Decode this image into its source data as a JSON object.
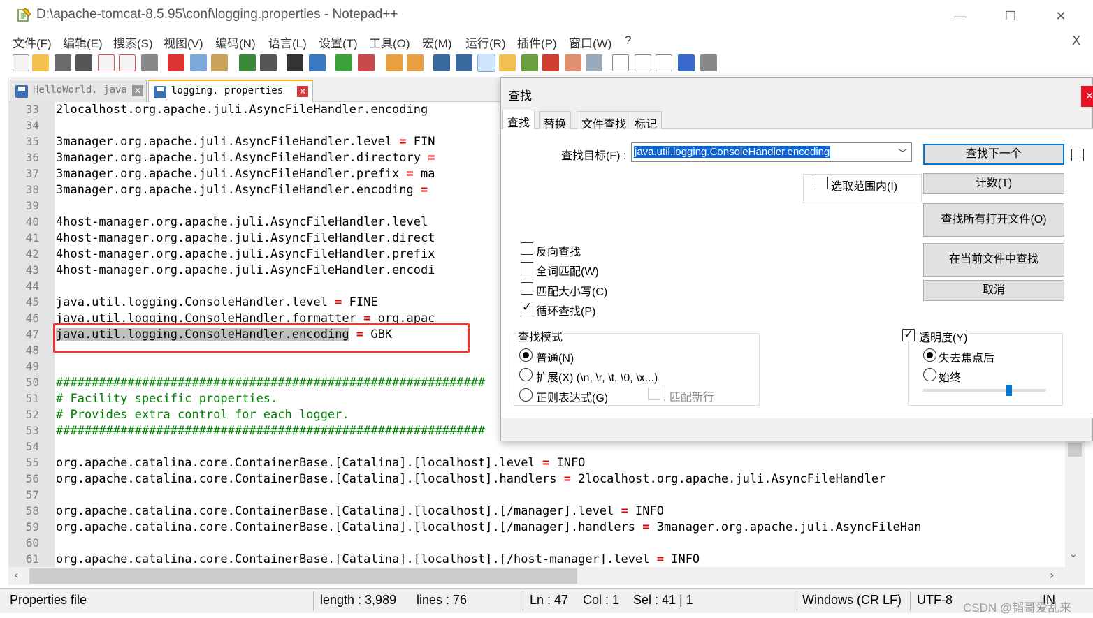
{
  "window": {
    "title": "D:\\apache-tomcat-8.5.95\\conf\\logging.properties - Notepad++",
    "min": "—",
    "max": "☐",
    "close": "✕"
  },
  "menu": [
    "文件(F)",
    "编辑(E)",
    "搜索(S)",
    "视图(V)",
    "编码(N)",
    "语言(L)",
    "设置(T)",
    "工具(O)",
    "宏(M)",
    "运行(R)",
    "插件(P)",
    "窗口(W)",
    "?"
  ],
  "menu_close": "X",
  "tabs": [
    {
      "label": "HelloWorld. java",
      "active": false
    },
    {
      "label": "logging. properties",
      "active": true
    }
  ],
  "editor": {
    "lines": [
      {
        "n": "33",
        "t": "2localhost.org.apache.juli.AsyncFileHandler.encoding"
      },
      {
        "n": "34",
        "t": ""
      },
      {
        "n": "35",
        "t": "3manager.org.apache.juli.AsyncFileHandler.level ",
        "eq": "=",
        "r": " FIN"
      },
      {
        "n": "36",
        "t": "3manager.org.apache.juli.AsyncFileHandler.directory ",
        "eq": "="
      },
      {
        "n": "37",
        "t": "3manager.org.apache.juli.AsyncFileHandler.prefix ",
        "eq": "=",
        "r": " ma"
      },
      {
        "n": "38",
        "t": "3manager.org.apache.juli.AsyncFileHandler.encoding ",
        "eq": "="
      },
      {
        "n": "39",
        "t": ""
      },
      {
        "n": "40",
        "t": "4host-manager.org.apache.juli.AsyncFileHandler.level"
      },
      {
        "n": "41",
        "t": "4host-manager.org.apache.juli.AsyncFileHandler.direct"
      },
      {
        "n": "42",
        "t": "4host-manager.org.apache.juli.AsyncFileHandler.prefix"
      },
      {
        "n": "43",
        "t": "4host-manager.org.apache.juli.AsyncFileHandler.encodi"
      },
      {
        "n": "44",
        "t": ""
      },
      {
        "n": "45",
        "t": "java.util.logging.ConsoleHandler.level ",
        "eq": "=",
        "r": " FINE"
      },
      {
        "n": "46",
        "t": "java.util.logging.ConsoleHandler.formatter ",
        "eq": "=",
        "r": " org.apac"
      },
      {
        "n": "47",
        "t": "java.util.logging.ConsoleHandler.encoding",
        "sel": true,
        "mid": " ",
        "eq": "=",
        "r": " GBK"
      },
      {
        "n": "48",
        "t": ""
      },
      {
        "n": "49",
        "t": ""
      },
      {
        "n": "50",
        "t": "############################################################",
        "cm": true
      },
      {
        "n": "51",
        "t": "# Facility specific properties.",
        "cm": true
      },
      {
        "n": "52",
        "t": "# Provides extra control for each logger.",
        "cm": true
      },
      {
        "n": "53",
        "t": "############################################################",
        "cm": true
      },
      {
        "n": "54",
        "t": ""
      },
      {
        "n": "55",
        "t": "org.apache.catalina.core.ContainerBase.[Catalina].[localhost].level ",
        "eq": "=",
        "r": " INFO"
      },
      {
        "n": "56",
        "t": "org.apache.catalina.core.ContainerBase.[Catalina].[localhost].handlers ",
        "eq": "=",
        "r": " 2localhost.org.apache.juli.AsyncFileHandler"
      },
      {
        "n": "57",
        "t": ""
      },
      {
        "n": "58",
        "t": "org.apache.catalina.core.ContainerBase.[Catalina].[localhost].[/manager].level ",
        "eq": "=",
        "r": " INFO"
      },
      {
        "n": "59",
        "t": "org.apache.catalina.core.ContainerBase.[Catalina].[localhost].[/manager].handlers ",
        "eq": "=",
        "r": " 3manager.org.apache.juli.AsyncFileHan"
      },
      {
        "n": "60",
        "t": ""
      },
      {
        "n": "61",
        "t": "org.apache.catalina.core.ContainerBase.[Catalina].[localhost].[/host-manager].level ",
        "eq": "=",
        "r": " INFO"
      }
    ]
  },
  "status": {
    "filetype": "Properties file",
    "length": "length : 3,989",
    "lines": "lines : 76",
    "ln": "Ln : 47",
    "col": "Col : 1",
    "sel": "Sel : 41 | 1",
    "eol": "Windows (CR LF)",
    "enc": "UTF-8",
    "ins": "IN"
  },
  "watermark": "CSDN @韬哥爱乱来",
  "find": {
    "title": "查找",
    "close": "✕",
    "tabs": [
      "查找",
      "替换",
      "文件查找",
      "标记"
    ],
    "target_label": "查找目标(F) :",
    "target_value": "java.util.logging.ConsoleHandler.encoding",
    "in_selection": "选取范围内(I)",
    "buttons": {
      "find_next": "查找下一个",
      "count": "计数(T)",
      "find_all_open": "查找所有打开文件(O)",
      "find_in_current": "在当前文件中查找",
      "cancel": "取消"
    },
    "options": {
      "backward": "反向查找",
      "whole_word": "全词匹配(W)",
      "match_case": "匹配大小写(C)",
      "wrap": "循环查找(P)"
    },
    "mode": {
      "label": "查找模式",
      "normal": "普通(N)",
      "extended": "扩展(X) (\\n, \\r, \\t, \\0, \\x...)",
      "regex": "正则表达式(G)",
      "newline": ". 匹配新行"
    },
    "transparency": {
      "label": "透明度(Y)",
      "on_lose_focus": "失去焦点后",
      "always": "始终",
      "level": 0.7
    }
  }
}
